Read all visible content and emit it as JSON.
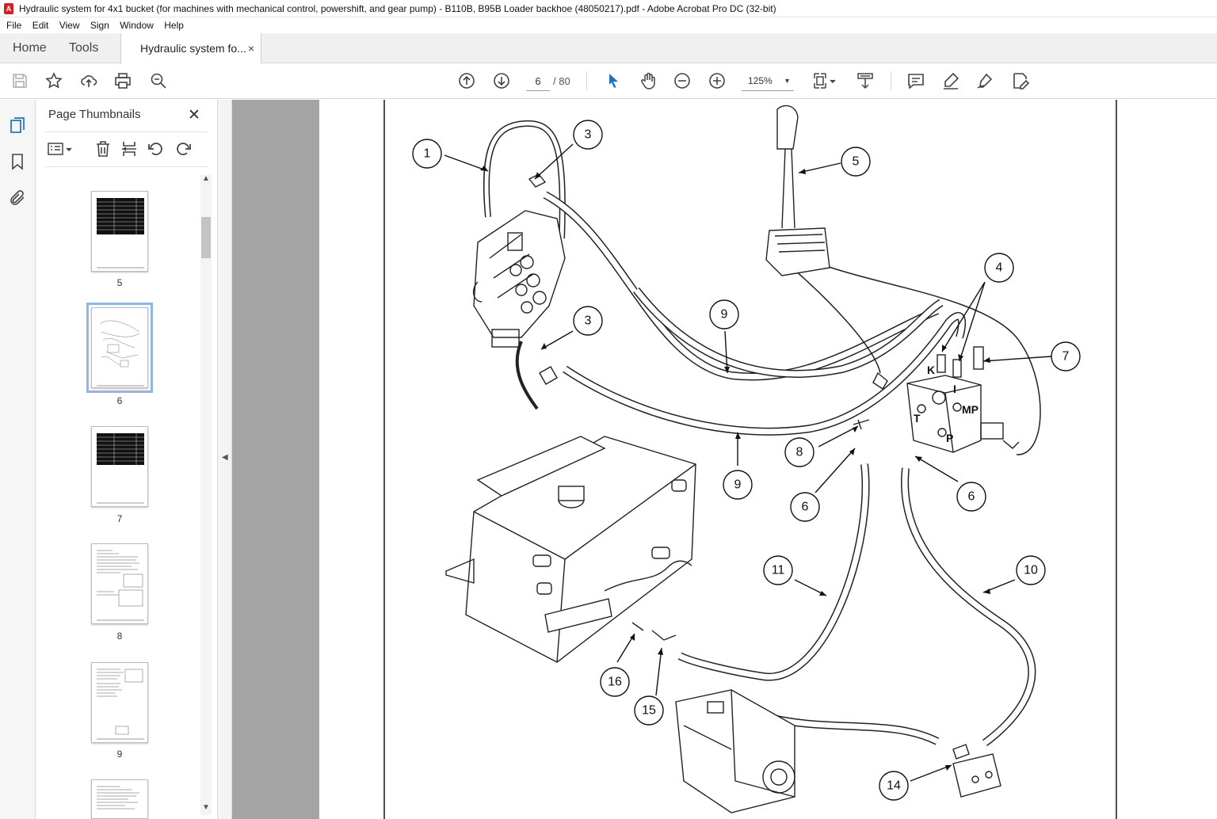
{
  "window": {
    "title": "Hydraulic system for 4x1 bucket (for machines with mechanical control, powershift, and gear pump) - B110B, B95B Loader backhoe (48050217).pdf - Adobe Acrobat Pro DC (32-bit)"
  },
  "menu": [
    "File",
    "Edit",
    "View",
    "Sign",
    "Window",
    "Help"
  ],
  "tabs": {
    "home": "Home",
    "tools": "Tools",
    "document": "Hydraulic system fo...",
    "close": "×"
  },
  "toolbar": {
    "current_page": "6",
    "page_total": "/ 80",
    "zoom": "125%",
    "icons": [
      "save-icon",
      "star-icon",
      "upload-icon",
      "print-icon",
      "search-zoom-icon",
      "arrow-up-icon",
      "arrow-down-icon",
      "select-cursor-icon",
      "hand-icon",
      "zoom-out-icon",
      "zoom-in-icon",
      "page-fit-icon",
      "scroll-mode-icon",
      "comment-icon",
      "highlight-pen-icon",
      "sign-icon",
      "edit-pdf-icon"
    ]
  },
  "panel": {
    "title": "Page Thumbnails",
    "close": "✕",
    "thumbnails": [
      {
        "label": "5"
      },
      {
        "label": "6"
      },
      {
        "label": "7"
      },
      {
        "label": "8"
      },
      {
        "label": "9"
      }
    ]
  },
  "drawing": {
    "callouts": [
      "1",
      "3",
      "5",
      "4",
      "7",
      "9",
      "3",
      "8",
      "9",
      "6",
      "6",
      "11",
      "10",
      "16",
      "15",
      "14"
    ],
    "ports": [
      "K",
      "I",
      "T",
      "MP",
      "P"
    ]
  },
  "colors": {
    "accent_blue": "#1a73c8",
    "document_gray": "#a4a4a4",
    "selected_thumb": "#8fb6e6"
  }
}
